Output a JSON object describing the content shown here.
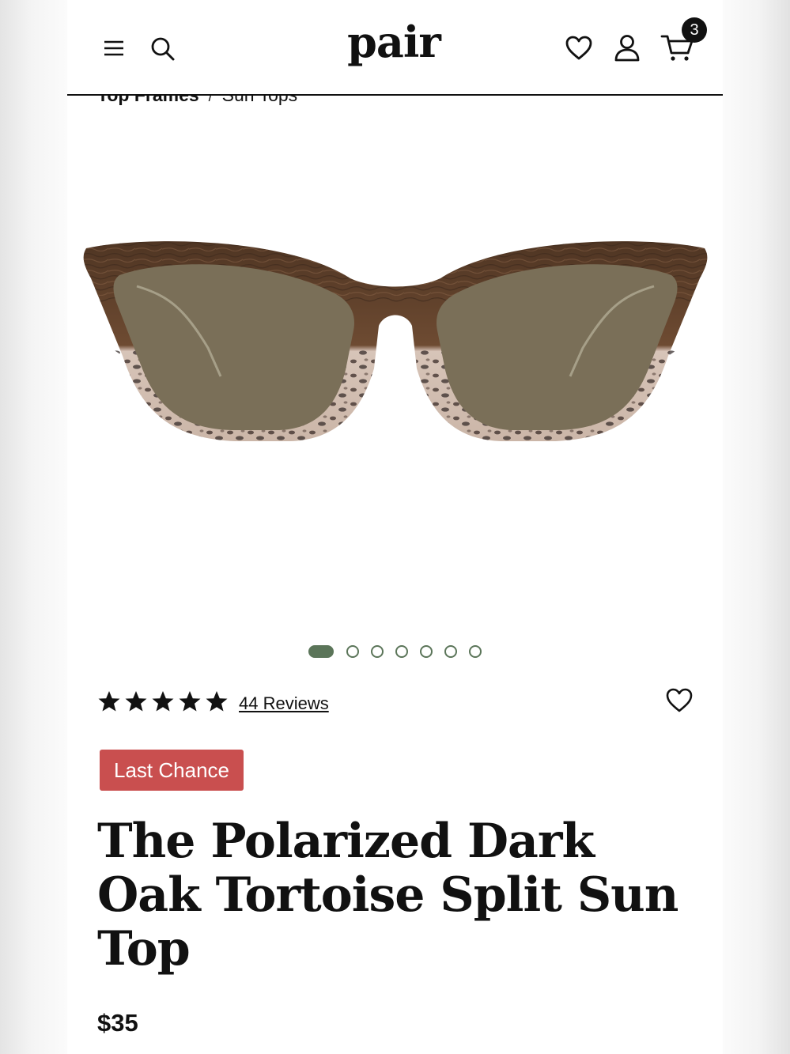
{
  "header": {
    "logo": "pair",
    "cart_count": "3",
    "icons": [
      "menu-icon",
      "search-icon",
      "heart-icon",
      "account-icon",
      "cart-icon"
    ]
  },
  "breadcrumb": {
    "items": [
      "Top Frames",
      "Sun Tops"
    ],
    "separator": "/"
  },
  "gallery": {
    "total_images": 7,
    "active_index": 0,
    "accent_color": "#5b7559"
  },
  "product": {
    "rating": 5,
    "reviews_label": "44 Reviews",
    "badge": "Last Chance",
    "badge_color": "#c94f4f",
    "title": "The Polarized Dark Oak Tortoise Split Sun Top",
    "price": "$35"
  }
}
